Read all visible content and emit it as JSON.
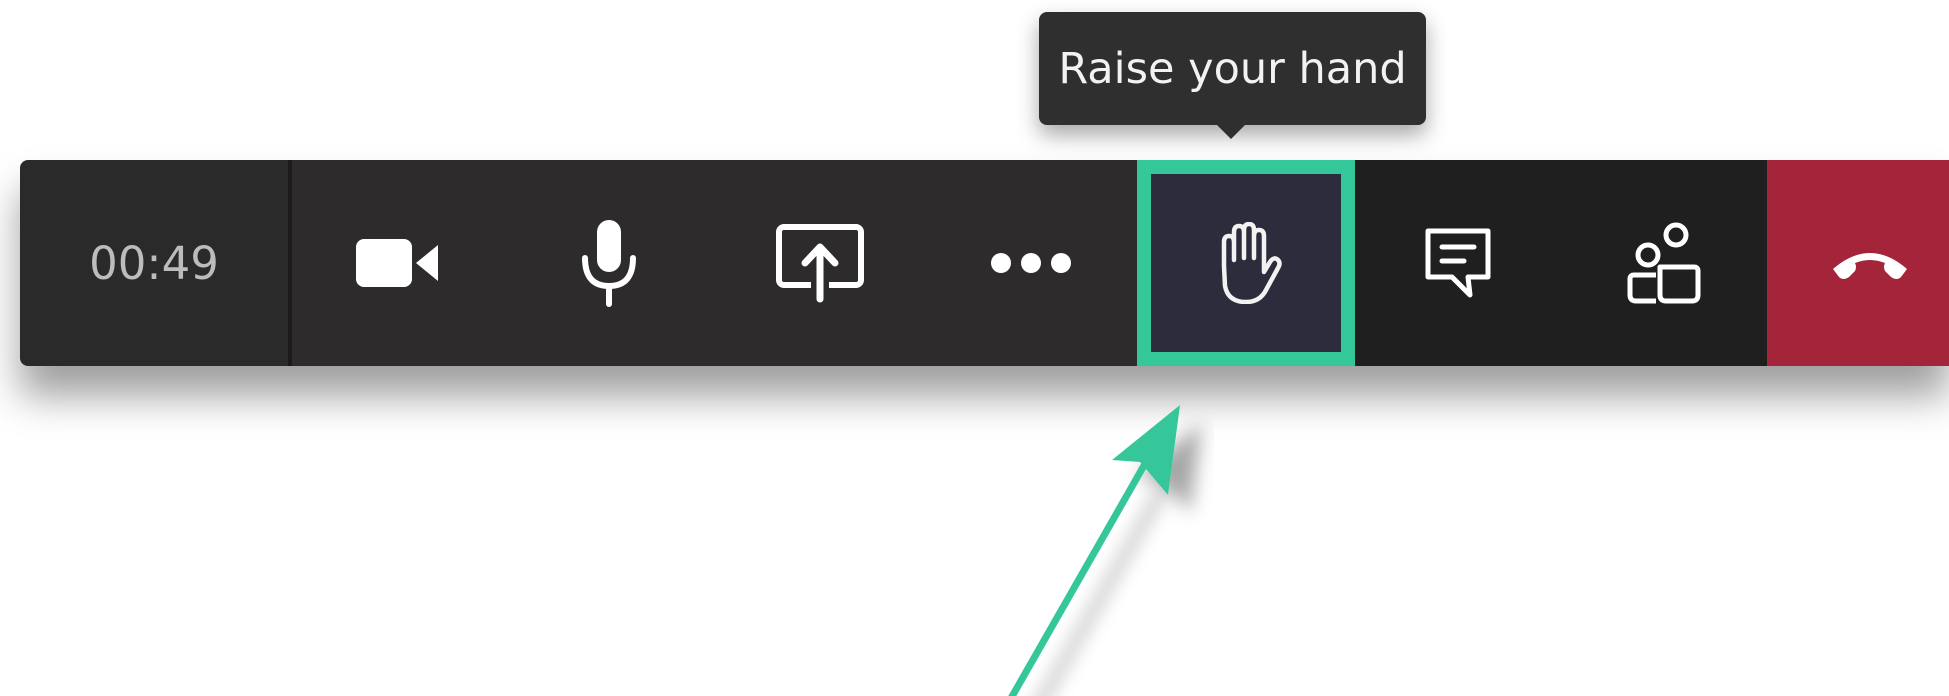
{
  "tooltip": {
    "text": "Raise your hand"
  },
  "toolbar": {
    "timer": "00:49",
    "buttons": [
      {
        "name": "camera",
        "icon": "video-camera-icon"
      },
      {
        "name": "microphone",
        "icon": "microphone-icon"
      },
      {
        "name": "share",
        "icon": "share-screen-icon"
      },
      {
        "name": "more",
        "icon": "more-dots-icon"
      },
      {
        "name": "raise-hand",
        "icon": "hand-icon",
        "highlighted": true
      },
      {
        "name": "chat",
        "icon": "chat-icon"
      },
      {
        "name": "participants",
        "icon": "people-icon"
      },
      {
        "name": "hang-up",
        "icon": "phone-hangup-icon"
      }
    ]
  },
  "colors": {
    "highlight": "#34c79a",
    "hangup": "#a4243a",
    "toolbar_dark": "#2d2b2b",
    "tooltip_bg": "#2f2f2f"
  }
}
